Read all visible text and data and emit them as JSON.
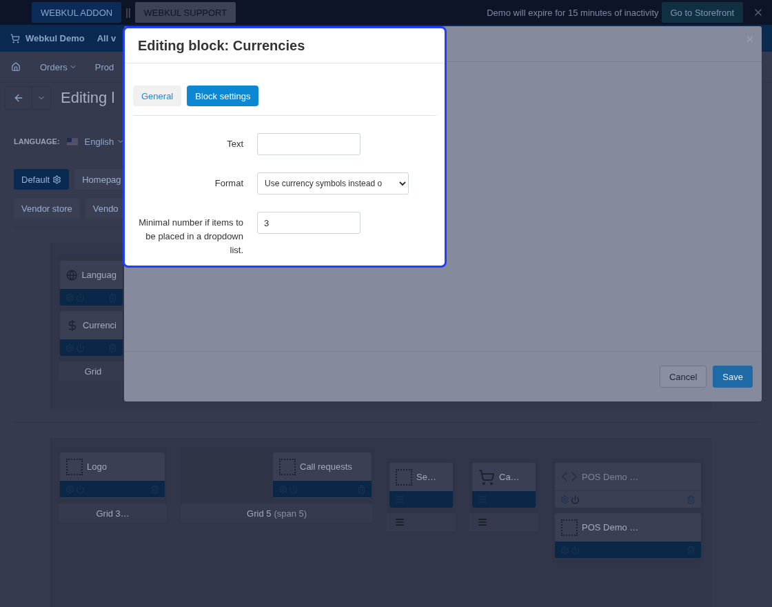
{
  "top_bar": {
    "buttons": [
      {
        "label": "WEBKUL ADDON",
        "selected": true
      },
      {
        "label": "WEBKUL SUPPORT",
        "selected": false
      }
    ],
    "separator": "||",
    "notice": "Demo will expire for 15 minutes of inactivity",
    "storefront_button": "Go to Storefront"
  },
  "nav_bar": {
    "store": "Webkul Demo",
    "items": [
      "All v"
    ]
  },
  "menu": {
    "items": [
      {
        "label": "Orders",
        "dropdown": true
      },
      {
        "label": "Prod",
        "dropdown": false
      }
    ]
  },
  "page_title": "Editing l",
  "language": {
    "label": "LANGUAGE:",
    "value": "English"
  },
  "layouts": [
    {
      "label": "Default",
      "selected": true
    },
    {
      "label": "Homepag",
      "selected": false
    },
    {
      "label": "Vendor store",
      "selected": false
    },
    {
      "label": "Vendo",
      "selected": false
    }
  ],
  "top_section": {
    "blocks": [
      {
        "name": "Languag",
        "kind": "globe",
        "active": true
      },
      {
        "name": "Currenci",
        "kind": "dollar",
        "active": true
      }
    ],
    "grid_label": "Grid"
  },
  "bottom_section": [
    {
      "kind": "grid",
      "label": "Grid 3…",
      "blocks": [
        {
          "name": "Logo",
          "kind": "placeholder",
          "active": true
        }
      ]
    },
    {
      "kind": "grid",
      "label": "Grid 5",
      "span": "(span 5)",
      "blocks": [
        {
          "name": "Call requests",
          "kind": "placeholder",
          "active": true
        }
      ]
    },
    {
      "kind": "column",
      "blocks": [
        {
          "name": "Se…",
          "kind": "placeholder",
          "active": true
        }
      ]
    },
    {
      "kind": "column",
      "blocks": [
        {
          "name": "Ca…",
          "kind": "cart",
          "active": true
        }
      ]
    },
    {
      "kind": "stack",
      "blocks": [
        {
          "name": "POS Demo …",
          "kind": "code",
          "active": false
        },
        {
          "name": "POS Demo …",
          "kind": "placeholder",
          "active": true
        }
      ]
    }
  ],
  "modal": {
    "title": "Editing block: Currencies",
    "tabs": [
      {
        "label": "General",
        "selected": false
      },
      {
        "label": "Block settings",
        "selected": true
      }
    ],
    "fields": [
      {
        "kind": "text",
        "label": "Text"
      },
      {
        "kind": "select",
        "label": "Format",
        "value": "Use currency symbols instead o"
      },
      {
        "kind": "text",
        "label": "Minimal number if items to be placed in a dropdown list.",
        "value": "3"
      }
    ],
    "buttons": [
      {
        "label": "Cancel",
        "kind": "secondary"
      },
      {
        "label": "Save",
        "kind": "primary"
      }
    ]
  }
}
